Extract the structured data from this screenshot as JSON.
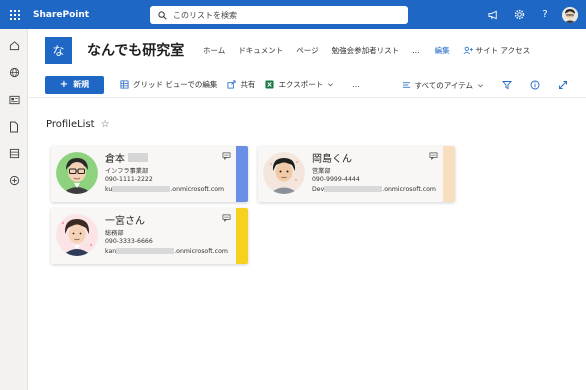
{
  "suite": {
    "brand": "SharePoint",
    "search_placeholder": "このリストを検索",
    "icons": [
      "megaphone-icon",
      "settings-icon",
      "help-icon"
    ],
    "help_glyph": "?"
  },
  "rail": {
    "icons": [
      "home-icon",
      "globe-icon",
      "news-icon",
      "document-icon",
      "list-icon",
      "add-icon"
    ]
  },
  "site": {
    "logo_letter": "な",
    "title": "なんでも研究室",
    "nav": [
      "ホーム",
      "ドキュメント",
      "ページ",
      "勉強会参加者リスト",
      "…"
    ],
    "edit": "編集",
    "access": "サイト アクセス"
  },
  "commands": {
    "new": "新規",
    "grid_edit": "グリッド ビューでの編集",
    "share": "共有",
    "export": "エクスポート",
    "more": "…",
    "view": "すべてのアイテム"
  },
  "list": {
    "title": "ProfileList",
    "cards": [
      {
        "name": "倉本",
        "dept": "インフラ事業部",
        "phone": "090-1111-2222",
        "email_prefix": "ku",
        "email_suffix": ".onmicrosoft.com",
        "accent": "#6b8ee6",
        "avatar_bg": "#8ed17e"
      },
      {
        "name": "岡島くん",
        "dept": "営業部",
        "phone": "090-9999-4444",
        "email_prefix": "Dev",
        "email_suffix": ".onmicrosoft.com",
        "accent": "#f7dfbf",
        "avatar_bg": "#f4e6dc"
      },
      {
        "name": "一宮さん",
        "dept": "総務部",
        "phone": "090-3333-6666",
        "email_prefix": "kan",
        "email_suffix": ".onmicrosoft.com",
        "accent": "#f5d21e",
        "avatar_bg": "#fbe3e6"
      }
    ]
  },
  "colors": {
    "brand": "#1e67c4",
    "rail": "#f3f2f1"
  }
}
